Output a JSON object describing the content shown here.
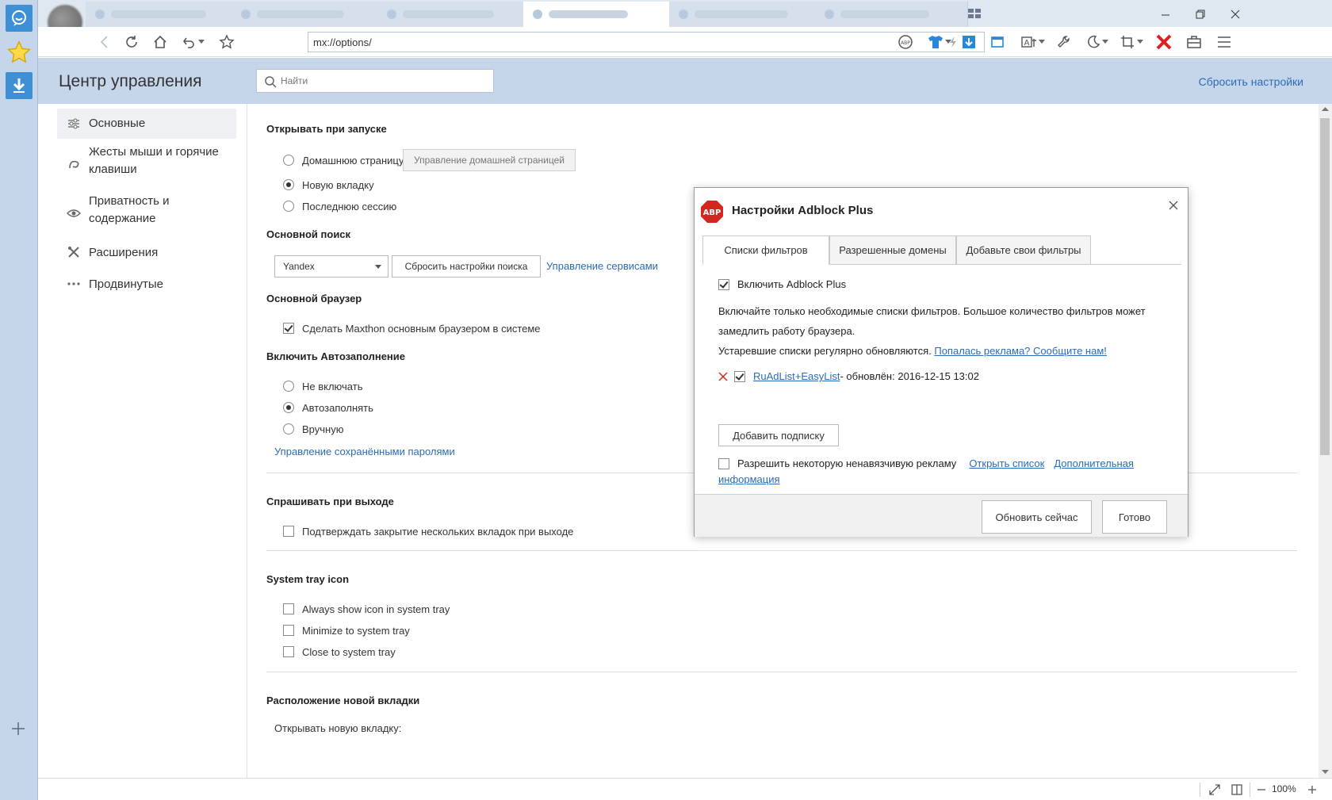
{
  "browser": {
    "address_url": "mx://options/",
    "zoom": "100%"
  },
  "header": {
    "title": "Центр управления",
    "search_placeholder": "Найти",
    "reset_link": "Сбросить настройки"
  },
  "nav": {
    "items": [
      {
        "label": "Основные"
      },
      {
        "label": "Жесты мыши и горячие клавиши"
      },
      {
        "label": "Приватность и содержание"
      },
      {
        "label": "Расширения"
      },
      {
        "label": "Продвинутые"
      }
    ]
  },
  "content": {
    "startup": {
      "title": "Открывать при запуске",
      "opt_home": "Домашнюю страницу",
      "home_btn": "Управление домашней страницей",
      "opt_newtab": "Новую вкладку",
      "opt_session": "Последнюю сессию"
    },
    "search": {
      "title": "Основной поиск",
      "engine": "Yandex",
      "reset_btn": "Сбросить настройки поиска",
      "manage_link": "Управление сервисами"
    },
    "default_browser": {
      "title": "Основной браузер",
      "opt": "Сделать Maxthon основным браузером в системе"
    },
    "autofill": {
      "title": "Включить Автозаполнение",
      "opt_off": "Не включать",
      "opt_auto": "Автозаполнять",
      "opt_manual": "Вручную",
      "passwords_link": "Управление сохранёнными паролями"
    },
    "exit": {
      "title": "Спрашивать при выходе",
      "opt": "Подтверждать закрытие нескольких вкладок при выходе"
    },
    "tray": {
      "title": "System tray icon",
      "opt_always": "Always show icon in system tray",
      "opt_minimize": "Minimize to system tray",
      "opt_close": "Close to system tray"
    },
    "newtab_pos": {
      "title": "Расположение новой вкладки",
      "label": "Открывать новую вкладку:"
    }
  },
  "dialog": {
    "logo": "ABP",
    "title": "Настройки Adblock Plus",
    "tabs": [
      "Списки фильтров",
      "Разрешенные домены",
      "Добавьте свои фильтры"
    ],
    "enable_label": "Включить Adblock Plus",
    "info_line1": "Включайте только необходимые списки фильтров. Большое количество фильтров может",
    "info_line2": "замедлить работу браузера.",
    "info_line3": "Устаревшие списки регулярно обновляются.",
    "report_link": "Попалась реклама? Сообщите нам!",
    "filter_name": "RuAdList+EasyList",
    "filter_updated": " - обновлён: 2016-12-15 13:02",
    "add_sub_btn": "Добавить подписку",
    "acceptable_ads": "Разрешить некоторую ненавязчивую рекламу",
    "open_list_link": "Открыть список",
    "more_info_1": "Дополнительная",
    "more_info_2": "информация",
    "update_btn": "Обновить сейчас",
    "done_btn": "Готово"
  },
  "colors": {
    "accent": "#2b6bb8",
    "header_bg": "#c6d6ea",
    "close_red": "#e02020"
  }
}
